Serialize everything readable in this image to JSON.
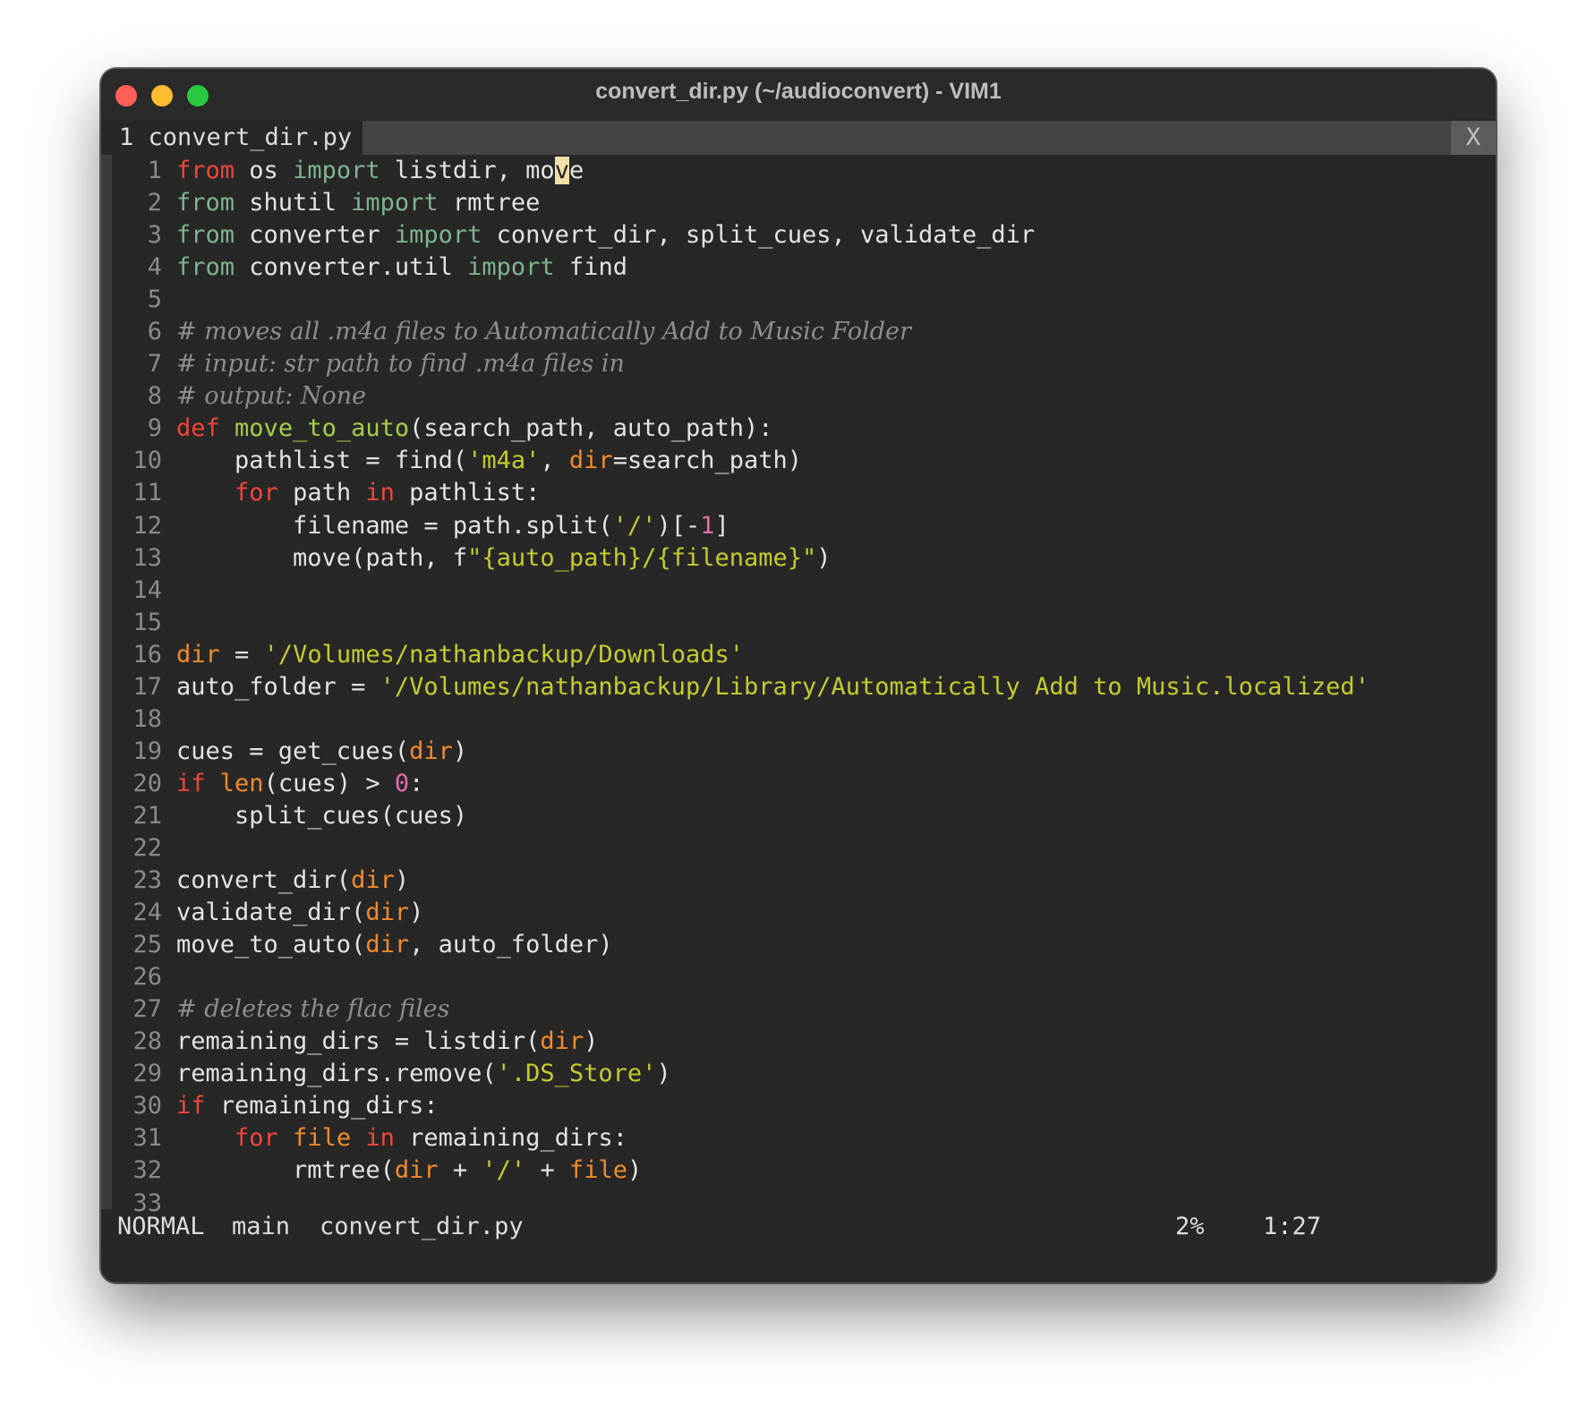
{
  "window": {
    "title": "convert_dir.py (~/audioconvert) - VIM1"
  },
  "tabline": {
    "active_tab": "1 convert_dir.py",
    "close_label": "X"
  },
  "code_lines": [
    [
      [
        "kw",
        "from"
      ],
      [
        "txt",
        " os "
      ],
      [
        "imp",
        "import"
      ],
      [
        "txt",
        " listdir, mo"
      ],
      [
        "cursor",
        "v"
      ],
      [
        "txt",
        "e"
      ]
    ],
    [
      [
        "imp",
        "from"
      ],
      [
        "txt",
        " shutil "
      ],
      [
        "imp",
        "import"
      ],
      [
        "txt",
        " rmtree"
      ]
    ],
    [
      [
        "imp",
        "from"
      ],
      [
        "txt",
        " converter "
      ],
      [
        "imp",
        "import"
      ],
      [
        "txt",
        " convert_dir, split_cues, validate_dir"
      ]
    ],
    [
      [
        "imp",
        "from"
      ],
      [
        "txt",
        " converter.util "
      ],
      [
        "imp",
        "import"
      ],
      [
        "txt",
        " find"
      ]
    ],
    [],
    [
      [
        "cmt",
        "# moves all .m4a files to Automatically Add to Music Folder"
      ]
    ],
    [
      [
        "cmt",
        "# input: str path to find .m4a files in"
      ]
    ],
    [
      [
        "cmt",
        "# output: None"
      ]
    ],
    [
      [
        "kw",
        "def"
      ],
      [
        "txt",
        " "
      ],
      [
        "fn",
        "move_to_auto"
      ],
      [
        "txt",
        "(search_path, auto_path):"
      ]
    ],
    [
      [
        "txt",
        "    pathlist = find("
      ],
      [
        "str",
        "'m4a'"
      ],
      [
        "txt",
        ", "
      ],
      [
        "var",
        "dir"
      ],
      [
        "txt",
        "=search_path)"
      ]
    ],
    [
      [
        "txt",
        "    "
      ],
      [
        "kw",
        "for"
      ],
      [
        "txt",
        " path "
      ],
      [
        "kw",
        "in"
      ],
      [
        "txt",
        " pathlist:"
      ]
    ],
    [
      [
        "txt",
        "        filename = path.split("
      ],
      [
        "str",
        "'/'"
      ],
      [
        "txt",
        ")[-"
      ],
      [
        "num",
        "1"
      ],
      [
        "txt",
        "]"
      ]
    ],
    [
      [
        "txt",
        "        move(path, f"
      ],
      [
        "str",
        "\""
      ],
      [
        "str",
        "{auto_path}/{filename}"
      ],
      [
        "str",
        "\""
      ],
      [
        "txt",
        ")"
      ]
    ],
    [],
    [],
    [
      [
        "var",
        "dir"
      ],
      [
        "txt",
        " = "
      ],
      [
        "str",
        "'/Volumes/nathanbackup/Downloads'"
      ]
    ],
    [
      [
        "txt",
        "auto_folder = "
      ],
      [
        "str",
        "'/Volumes/nathanbackup/Library/Automatically Add to Music.localized'"
      ]
    ],
    [],
    [
      [
        "txt",
        "cues = get_cues("
      ],
      [
        "var",
        "dir"
      ],
      [
        "txt",
        ")"
      ]
    ],
    [
      [
        "kw",
        "if"
      ],
      [
        "txt",
        " "
      ],
      [
        "var",
        "len"
      ],
      [
        "txt",
        "(cues) > "
      ],
      [
        "num",
        "0"
      ],
      [
        "txt",
        ":"
      ]
    ],
    [
      [
        "txt",
        "    split_cues(cues)"
      ]
    ],
    [],
    [
      [
        "txt",
        "convert_dir("
      ],
      [
        "var",
        "dir"
      ],
      [
        "txt",
        ")"
      ]
    ],
    [
      [
        "txt",
        "validate_dir("
      ],
      [
        "var",
        "dir"
      ],
      [
        "txt",
        ")"
      ]
    ],
    [
      [
        "txt",
        "move_to_auto("
      ],
      [
        "var",
        "dir"
      ],
      [
        "txt",
        ", auto_folder)"
      ]
    ],
    [],
    [
      [
        "cmt",
        "# deletes the flac files"
      ]
    ],
    [
      [
        "txt",
        "remaining_dirs = listdir("
      ],
      [
        "var",
        "dir"
      ],
      [
        "txt",
        ")"
      ]
    ],
    [
      [
        "txt",
        "remaining_dirs.remove("
      ],
      [
        "str",
        "'.DS_Store'"
      ],
      [
        "txt",
        ")"
      ]
    ],
    [
      [
        "kw",
        "if"
      ],
      [
        "txt",
        " remaining_dirs:"
      ]
    ],
    [
      [
        "txt",
        "    "
      ],
      [
        "kw",
        "for"
      ],
      [
        "txt",
        " "
      ],
      [
        "var",
        "file"
      ],
      [
        "txt",
        " "
      ],
      [
        "kw",
        "in"
      ],
      [
        "txt",
        " remaining_dirs:"
      ]
    ],
    [
      [
        "txt",
        "        rmtree("
      ],
      [
        "var",
        "dir"
      ],
      [
        "txt",
        " + "
      ],
      [
        "str",
        "'/'"
      ],
      [
        "txt",
        " + "
      ],
      [
        "var",
        "file"
      ],
      [
        "txt",
        ")"
      ]
    ],
    []
  ],
  "statusline": {
    "mode": "NORMAL",
    "branch": "main",
    "filename": "convert_dir.py",
    "percent": "2%",
    "position": "1:27"
  },
  "colors": {
    "background": "#272727",
    "keyword": "#f0453c",
    "import_keyword": "#7fb38f",
    "function": "#a6cd49",
    "string": "#c4cc2c",
    "comment": "#8d8d8d",
    "builtin": "#f08b2c",
    "number": "#e46ca6",
    "cursor": "#f0dfa9"
  }
}
